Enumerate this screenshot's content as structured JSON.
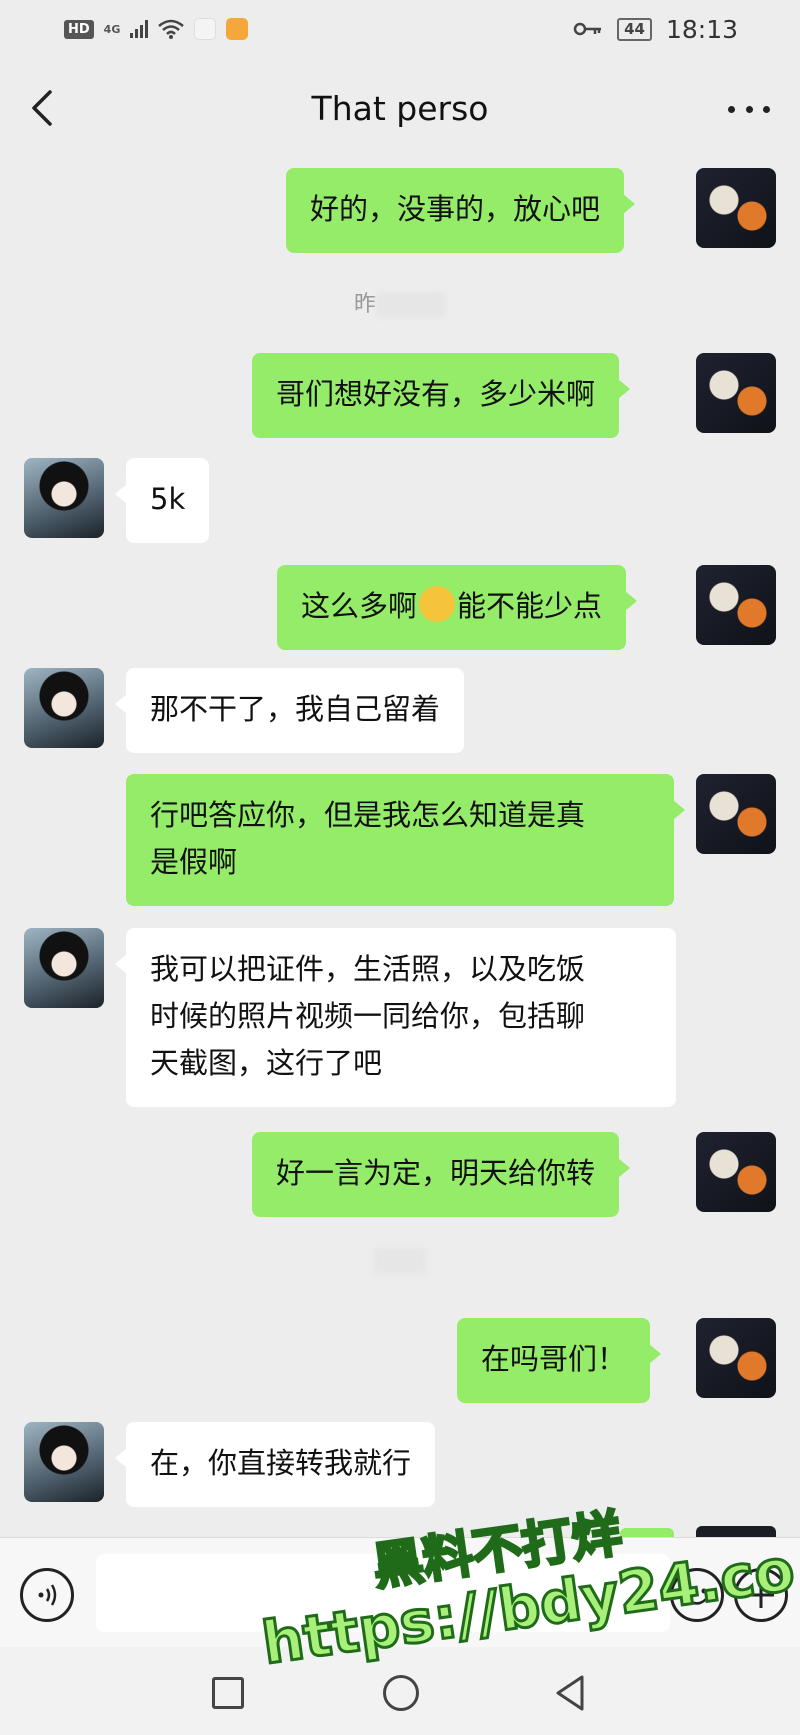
{
  "status_bar": {
    "hd_badge": "HD",
    "network": "4G",
    "battery": "44",
    "time": "18:13"
  },
  "header": {
    "title": "That perso"
  },
  "timestamps": {
    "t1": "昨",
    "t2": ""
  },
  "messages": [
    {
      "from": "me",
      "text": "好的，没事的，放心吧"
    },
    {
      "from": "me",
      "text": "哥们想好没有，多少米啊"
    },
    {
      "from": "them",
      "text": "5k"
    },
    {
      "from": "me",
      "text_before": "这么多啊",
      "emoji": "crying-laughing-emoji",
      "text_after": "能不能少点"
    },
    {
      "from": "them",
      "text": "那不干了，我自己留着"
    },
    {
      "from": "me",
      "lines": [
        "行吧答应你，但是我怎么知道是真",
        "是假啊"
      ]
    },
    {
      "from": "them",
      "lines": [
        "我可以把证件，生活照，以及吃饭",
        "时候的照片视频一同给你，包括聊",
        "天截图，这行了吧"
      ]
    },
    {
      "from": "me",
      "text": "好一言为定，明天给你转"
    },
    {
      "from": "me",
      "text": "在吗哥们！"
    },
    {
      "from": "them",
      "text": "在，你直接转我就行"
    }
  ],
  "input": {
    "placeholder": ""
  },
  "watermark": {
    "line1": "黑料不打烊",
    "line2": "https://bdy24.co"
  },
  "colors": {
    "my_bubble": "#95ec69",
    "their_bubble": "#ffffff",
    "background": "#ededed"
  }
}
